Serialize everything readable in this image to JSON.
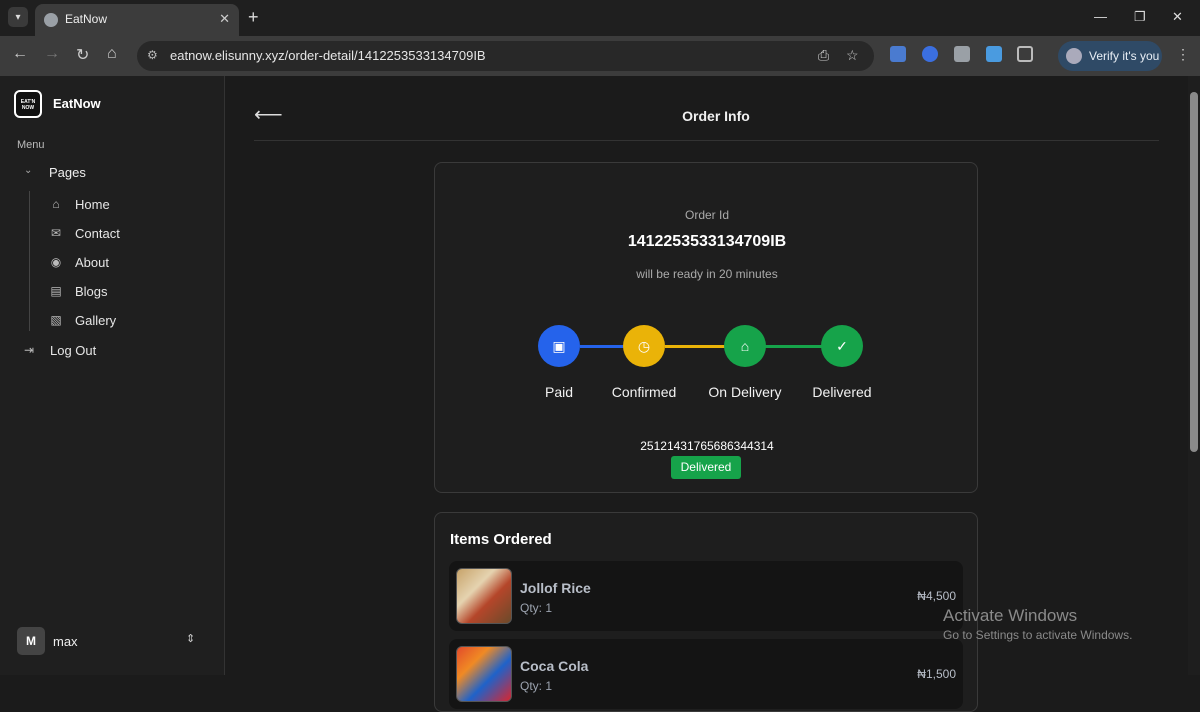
{
  "browser": {
    "tab_title": "EatNow",
    "url": "eatnow.elisunny.xyz/order-detail/1412253533134709IB",
    "verify_label": "Verify it's you",
    "icons": [
      "tab-search-icon",
      "globe-icon",
      "close-icon",
      "plus-icon",
      "back-icon",
      "forward-icon",
      "reload-icon",
      "home-icon",
      "site-info-icon",
      "install-icon",
      "star-icon",
      "extension-icon",
      "kebab-icon",
      "minimize-icon",
      "maximize-icon",
      "close-window-icon"
    ]
  },
  "sidebar": {
    "logo_text": "EAT'N NOW",
    "brand": "EatNow",
    "menu_label": "Menu",
    "pages_label": "Pages",
    "items": [
      {
        "label": "Home",
        "icon": "home-icon"
      },
      {
        "label": "Contact",
        "icon": "mail-icon"
      },
      {
        "label": "About",
        "icon": "user-circle-icon"
      },
      {
        "label": "Blogs",
        "icon": "newspaper-icon"
      },
      {
        "label": "Gallery",
        "icon": "image-icon"
      }
    ],
    "logout_label": "Log Out",
    "user": {
      "initial": "M",
      "name": "max"
    }
  },
  "main": {
    "title": "Order Info",
    "order": {
      "id_label": "Order Id",
      "id": "1412253533134709IB",
      "ready_text": "will be ready in 20 minutes",
      "tracking_no": "25121431765686344314",
      "status": "Delivered"
    },
    "steps": [
      {
        "label": "Paid",
        "color": "#2563eb",
        "icon": "money-icon"
      },
      {
        "label": "Confirmed",
        "color": "#eab308",
        "icon": "clock-icon"
      },
      {
        "label": "On Delivery",
        "color": "#16a34a",
        "icon": "bag-icon"
      },
      {
        "label": "Delivered",
        "color": "#16a34a",
        "icon": "check-icon"
      }
    ],
    "items_title": "Items Ordered",
    "items": [
      {
        "name": "Jollof Rice",
        "qty": "Qty: 1",
        "price": "₦4,500"
      },
      {
        "name": "Coca Cola",
        "qty": "Qty: 1",
        "price": "₦1,500"
      }
    ]
  },
  "watermark": {
    "title": "Activate Windows",
    "subtitle": "Go to Settings to activate Windows."
  }
}
